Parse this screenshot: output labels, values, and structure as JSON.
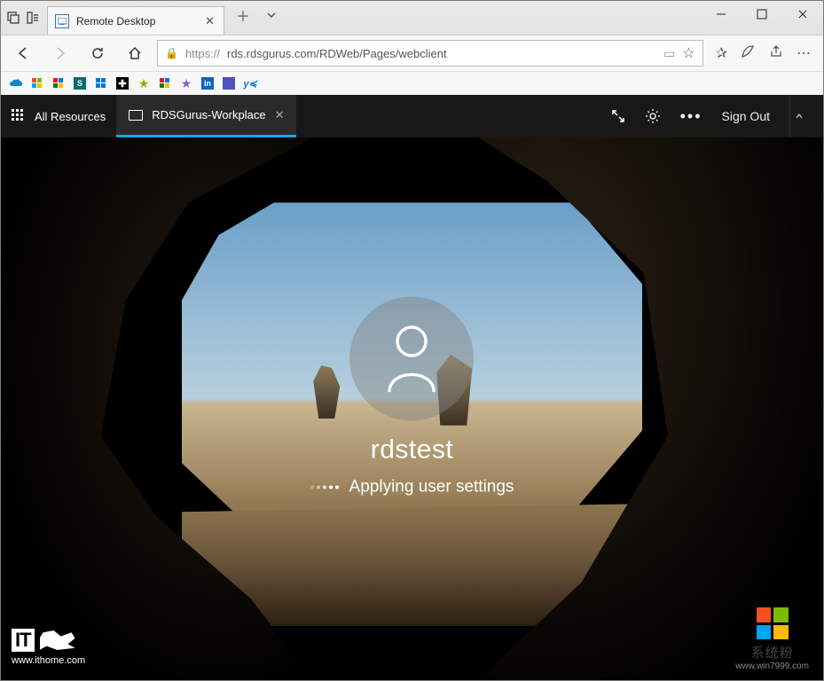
{
  "browser": {
    "tab_title": "Remote Desktop",
    "url_protocol": "https://",
    "url_rest": "rds.rdsgurus.com/RDWeb/Pages/webclient"
  },
  "appbar": {
    "all_resources": "All Resources",
    "workspace_tab": "RDSGurus-Workplace",
    "sign_out": "Sign Out"
  },
  "login": {
    "username": "rdstest",
    "status": "Applying user settings"
  },
  "watermark_left": {
    "logo_text": "IT",
    "url": "www.ithome.com"
  },
  "watermark_right": {
    "line1": "系统粉",
    "line2": "www.win7999.com"
  }
}
